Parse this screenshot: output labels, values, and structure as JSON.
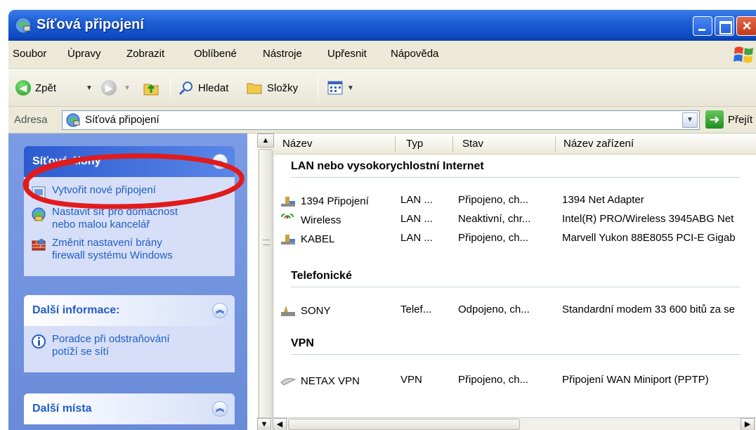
{
  "window": {
    "title": "Síťová připojení"
  },
  "menu": [
    "Soubor",
    "Úpravy",
    "Zobrazit",
    "Oblíbené",
    "Nástroje",
    "Upřesnit",
    "Nápověda"
  ],
  "toolbar": {
    "back": "Zpět",
    "search": "Hledat",
    "folders": "Složky"
  },
  "address": {
    "label": "Adresa",
    "value": "Síťová připojení",
    "go": "Přejít"
  },
  "tasks": {
    "network": {
      "title": "Síťové úlohy",
      "items": [
        "Vytvořit nové připojení",
        "Nastavit síť pro domácnost\nnebo malou kancelář",
        "Změnit nastavení brány\nfirewall systému Windows"
      ]
    },
    "more_info": {
      "title": "Další informace:",
      "items": [
        "Poradce při odstraňování\npotíží se sítí"
      ]
    },
    "other_places": {
      "title": "Další místa"
    }
  },
  "list": {
    "columns": [
      "Název",
      "Typ",
      "Stav",
      "Název zařízení"
    ],
    "groups": [
      {
        "title": "LAN nebo vysokorychlostní Internet",
        "rows": [
          {
            "name": "1394 Připojení",
            "type": "LAN ...",
            "status": "Připojeno, ch...",
            "device": "1394 Net Adapter"
          },
          {
            "name": "Wireless",
            "type": "LAN ...",
            "status": "Neaktivní, chr...",
            "device": "Intel(R) PRO/Wireless 3945ABG Net"
          },
          {
            "name": "KABEL",
            "type": "LAN ...",
            "status": "Připojeno, ch...",
            "device": "Marvell Yukon 88E8055 PCI-E Gigab"
          }
        ]
      },
      {
        "title": "Telefonické",
        "rows": [
          {
            "name": "SONY",
            "type": "Telef...",
            "status": "Odpojeno, ch...",
            "device": "Standardní modem 33 600 bitů za se"
          }
        ]
      },
      {
        "title": "VPN",
        "rows": [
          {
            "name": "NETAX VPN",
            "type": "VPN",
            "status": "Připojeno, ch...",
            "device": "Připojení WAN Miniport (PPTP)"
          }
        ]
      }
    ]
  },
  "colors": {
    "title_bar": "#0f4bc4",
    "task_pane": "#7b9ce4",
    "link": "#215dc6",
    "annotation": "#e11b1b"
  }
}
